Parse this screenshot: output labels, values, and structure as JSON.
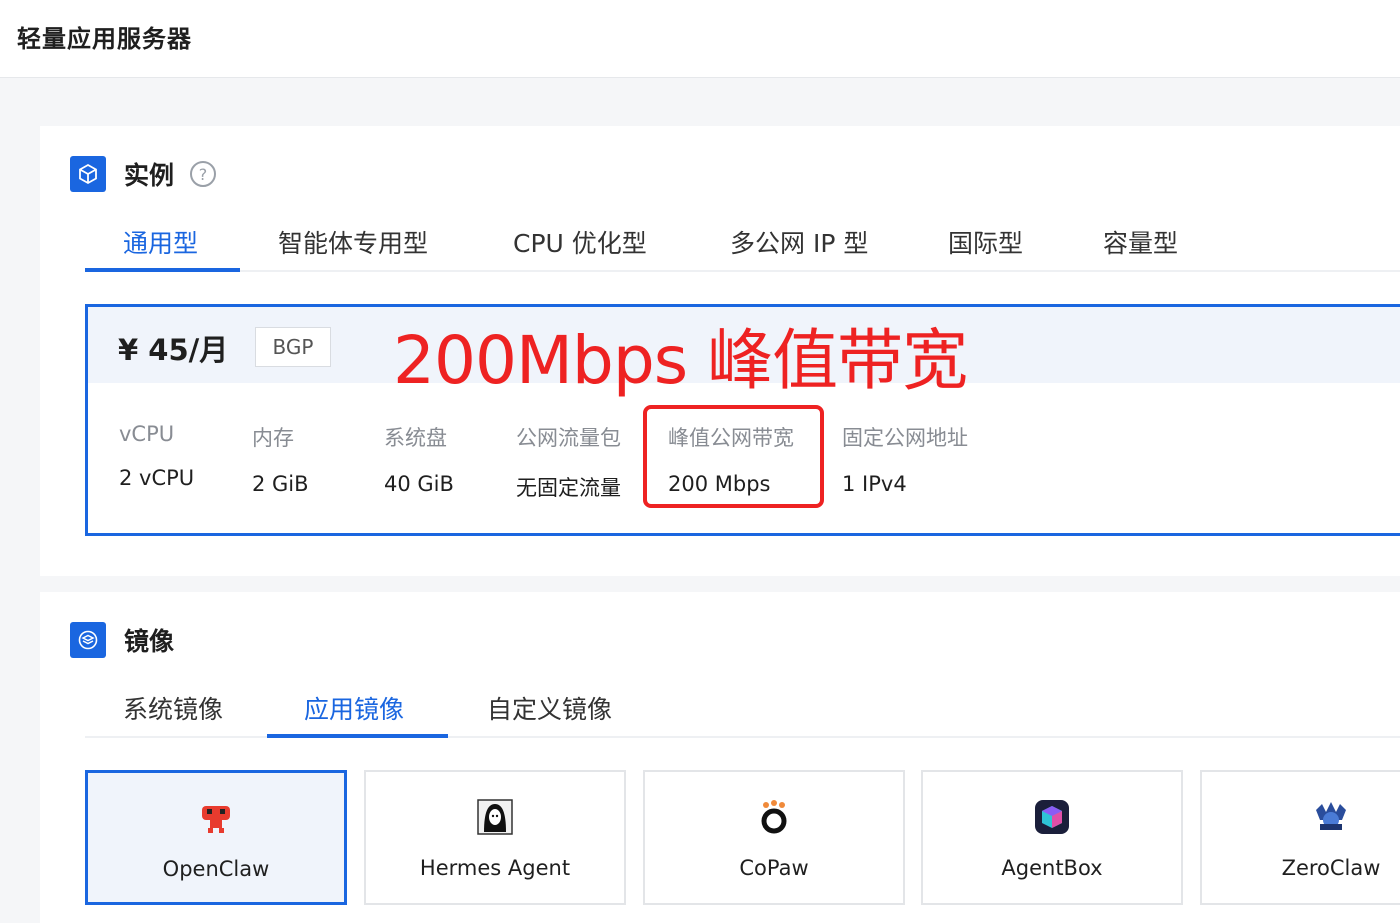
{
  "app": {
    "title": "轻量应用服务器"
  },
  "instance_section": {
    "title": "实例",
    "help_icon": "question-circle-icon",
    "tabs": [
      {
        "label": "通用型",
        "active": true
      },
      {
        "label": "智能体专用型",
        "active": false
      },
      {
        "label": "CPU 优化型",
        "active": false
      },
      {
        "label": "多公网 IP 型",
        "active": false
      },
      {
        "label": "国际型",
        "active": false
      },
      {
        "label": "容量型",
        "active": false
      }
    ],
    "plan": {
      "price": "¥ 45/月",
      "badge": "BGP",
      "annotation": "200Mbps 峰值带宽",
      "specs": [
        {
          "label": "vCPU",
          "value": "2 vCPU"
        },
        {
          "label": "内存",
          "value": "2 GiB"
        },
        {
          "label": "系统盘",
          "value": "40 GiB"
        },
        {
          "label": "公网流量包",
          "value": "无固定流量"
        },
        {
          "label": "峰值公网带宽",
          "value": "200 Mbps"
        },
        {
          "label": "固定公网地址",
          "value": "1 IPv4"
        }
      ]
    }
  },
  "image_section": {
    "title": "镜像",
    "tabs": [
      {
        "label": "系统镜像",
        "active": false
      },
      {
        "label": "应用镜像",
        "active": true
      },
      {
        "label": "自定义镜像",
        "active": false
      }
    ],
    "images": [
      {
        "name": "OpenClaw",
        "icon": "openclaw-logo-icon",
        "selected": true
      },
      {
        "name": "Hermes Agent",
        "icon": "hermes-agent-logo-icon",
        "selected": false
      },
      {
        "name": "CoPaw",
        "icon": "copaw-logo-icon",
        "selected": false
      },
      {
        "name": "AgentBox",
        "icon": "agentbox-logo-icon",
        "selected": false
      },
      {
        "name": "ZeroClaw",
        "icon": "zeroclaw-logo-icon",
        "selected": false
      }
    ]
  },
  "colors": {
    "accent": "#1a66e0",
    "annotation": "#ee2222",
    "muted_text": "#888c93"
  }
}
